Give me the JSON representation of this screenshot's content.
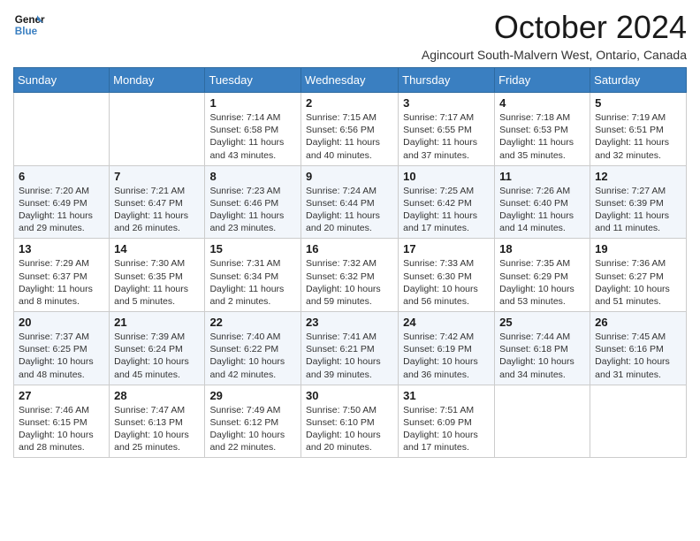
{
  "logo": {
    "line1": "General",
    "line2": "Blue"
  },
  "title": "October 2024",
  "location": "Agincourt South-Malvern West, Ontario, Canada",
  "days_of_week": [
    "Sunday",
    "Monday",
    "Tuesday",
    "Wednesday",
    "Thursday",
    "Friday",
    "Saturday"
  ],
  "weeks": [
    [
      {
        "day": null,
        "info": null
      },
      {
        "day": null,
        "info": null
      },
      {
        "day": "1",
        "info": "Sunrise: 7:14 AM\nSunset: 6:58 PM\nDaylight: 11 hours and 43 minutes."
      },
      {
        "day": "2",
        "info": "Sunrise: 7:15 AM\nSunset: 6:56 PM\nDaylight: 11 hours and 40 minutes."
      },
      {
        "day": "3",
        "info": "Sunrise: 7:17 AM\nSunset: 6:55 PM\nDaylight: 11 hours and 37 minutes."
      },
      {
        "day": "4",
        "info": "Sunrise: 7:18 AM\nSunset: 6:53 PM\nDaylight: 11 hours and 35 minutes."
      },
      {
        "day": "5",
        "info": "Sunrise: 7:19 AM\nSunset: 6:51 PM\nDaylight: 11 hours and 32 minutes."
      }
    ],
    [
      {
        "day": "6",
        "info": "Sunrise: 7:20 AM\nSunset: 6:49 PM\nDaylight: 11 hours and 29 minutes."
      },
      {
        "day": "7",
        "info": "Sunrise: 7:21 AM\nSunset: 6:47 PM\nDaylight: 11 hours and 26 minutes."
      },
      {
        "day": "8",
        "info": "Sunrise: 7:23 AM\nSunset: 6:46 PM\nDaylight: 11 hours and 23 minutes."
      },
      {
        "day": "9",
        "info": "Sunrise: 7:24 AM\nSunset: 6:44 PM\nDaylight: 11 hours and 20 minutes."
      },
      {
        "day": "10",
        "info": "Sunrise: 7:25 AM\nSunset: 6:42 PM\nDaylight: 11 hours and 17 minutes."
      },
      {
        "day": "11",
        "info": "Sunrise: 7:26 AM\nSunset: 6:40 PM\nDaylight: 11 hours and 14 minutes."
      },
      {
        "day": "12",
        "info": "Sunrise: 7:27 AM\nSunset: 6:39 PM\nDaylight: 11 hours and 11 minutes."
      }
    ],
    [
      {
        "day": "13",
        "info": "Sunrise: 7:29 AM\nSunset: 6:37 PM\nDaylight: 11 hours and 8 minutes."
      },
      {
        "day": "14",
        "info": "Sunrise: 7:30 AM\nSunset: 6:35 PM\nDaylight: 11 hours and 5 minutes."
      },
      {
        "day": "15",
        "info": "Sunrise: 7:31 AM\nSunset: 6:34 PM\nDaylight: 11 hours and 2 minutes."
      },
      {
        "day": "16",
        "info": "Sunrise: 7:32 AM\nSunset: 6:32 PM\nDaylight: 10 hours and 59 minutes."
      },
      {
        "day": "17",
        "info": "Sunrise: 7:33 AM\nSunset: 6:30 PM\nDaylight: 10 hours and 56 minutes."
      },
      {
        "day": "18",
        "info": "Sunrise: 7:35 AM\nSunset: 6:29 PM\nDaylight: 10 hours and 53 minutes."
      },
      {
        "day": "19",
        "info": "Sunrise: 7:36 AM\nSunset: 6:27 PM\nDaylight: 10 hours and 51 minutes."
      }
    ],
    [
      {
        "day": "20",
        "info": "Sunrise: 7:37 AM\nSunset: 6:25 PM\nDaylight: 10 hours and 48 minutes."
      },
      {
        "day": "21",
        "info": "Sunrise: 7:39 AM\nSunset: 6:24 PM\nDaylight: 10 hours and 45 minutes."
      },
      {
        "day": "22",
        "info": "Sunrise: 7:40 AM\nSunset: 6:22 PM\nDaylight: 10 hours and 42 minutes."
      },
      {
        "day": "23",
        "info": "Sunrise: 7:41 AM\nSunset: 6:21 PM\nDaylight: 10 hours and 39 minutes."
      },
      {
        "day": "24",
        "info": "Sunrise: 7:42 AM\nSunset: 6:19 PM\nDaylight: 10 hours and 36 minutes."
      },
      {
        "day": "25",
        "info": "Sunrise: 7:44 AM\nSunset: 6:18 PM\nDaylight: 10 hours and 34 minutes."
      },
      {
        "day": "26",
        "info": "Sunrise: 7:45 AM\nSunset: 6:16 PM\nDaylight: 10 hours and 31 minutes."
      }
    ],
    [
      {
        "day": "27",
        "info": "Sunrise: 7:46 AM\nSunset: 6:15 PM\nDaylight: 10 hours and 28 minutes."
      },
      {
        "day": "28",
        "info": "Sunrise: 7:47 AM\nSunset: 6:13 PM\nDaylight: 10 hours and 25 minutes."
      },
      {
        "day": "29",
        "info": "Sunrise: 7:49 AM\nSunset: 6:12 PM\nDaylight: 10 hours and 22 minutes."
      },
      {
        "day": "30",
        "info": "Sunrise: 7:50 AM\nSunset: 6:10 PM\nDaylight: 10 hours and 20 minutes."
      },
      {
        "day": "31",
        "info": "Sunrise: 7:51 AM\nSunset: 6:09 PM\nDaylight: 10 hours and 17 minutes."
      },
      {
        "day": null,
        "info": null
      },
      {
        "day": null,
        "info": null
      }
    ]
  ]
}
